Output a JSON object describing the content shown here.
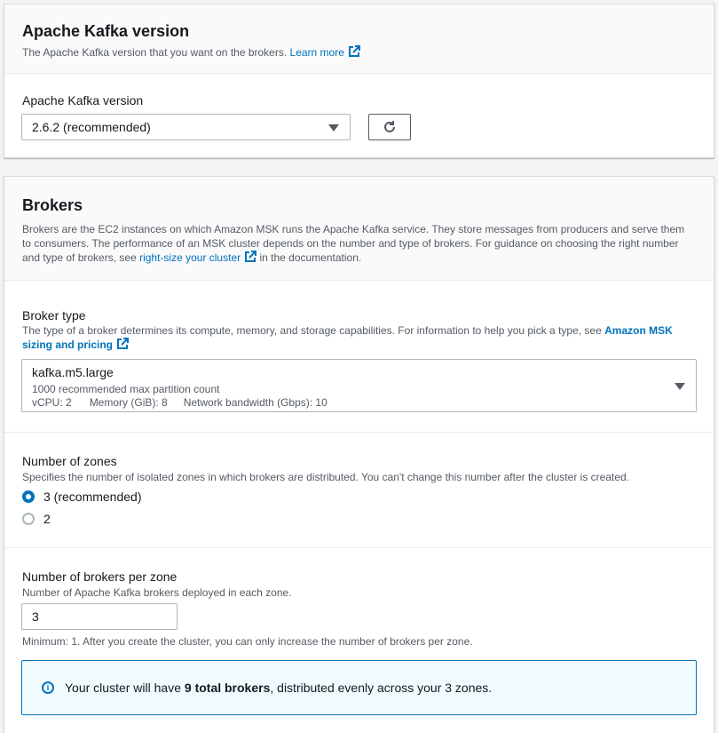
{
  "kafka_version": {
    "title": "Apache Kafka version",
    "description": "The Apache Kafka version that you want on the brokers.",
    "learn_more": "Learn more",
    "field_label": "Apache Kafka version",
    "selected": "2.6.2 (recommended)"
  },
  "brokers": {
    "title": "Brokers",
    "description_1": "Brokers are the EC2 instances on which Amazon MSK runs the Apache Kafka service. They store messages from producers and serve them to consumers. The performance of an MSK cluster depends on the number and type of brokers. For guidance on choosing the right number and type of brokers, see ",
    "description_link": "right-size your cluster",
    "description_2": " in the documentation.",
    "broker_type": {
      "label": "Broker type",
      "desc": "The type of a broker determines its compute, memory, and storage capabilities. For information to help you pick a type, see ",
      "desc_link": "Amazon MSK sizing and pricing",
      "selected_name": "kafka.m5.large",
      "selected_sub": "1000 recommended max partition count",
      "vcpu": "vCPU: 2",
      "memory": "Memory (GiB): 8",
      "network": "Network bandwidth (Gbps): 10"
    },
    "zones": {
      "label": "Number of zones",
      "desc": "Specifies the number of isolated zones in which brokers are distributed. You can't change this number after the cluster is created.",
      "options": [
        "3 (recommended)",
        "2"
      ]
    },
    "per_zone": {
      "label": "Number of brokers per zone",
      "desc": "Number of Apache Kafka brokers deployed in each zone.",
      "value": "3",
      "hint": "Minimum: 1. After you create the cluster, you can only increase the number of brokers per zone."
    },
    "info": {
      "prefix": "Your cluster will have ",
      "bold": "9 total brokers",
      "suffix": ", distributed evenly across your 3 zones."
    }
  },
  "colors": {
    "accent": "#0073bb",
    "info_bg": "#f1faff",
    "text": "#16191f",
    "muted": "#545b64"
  }
}
